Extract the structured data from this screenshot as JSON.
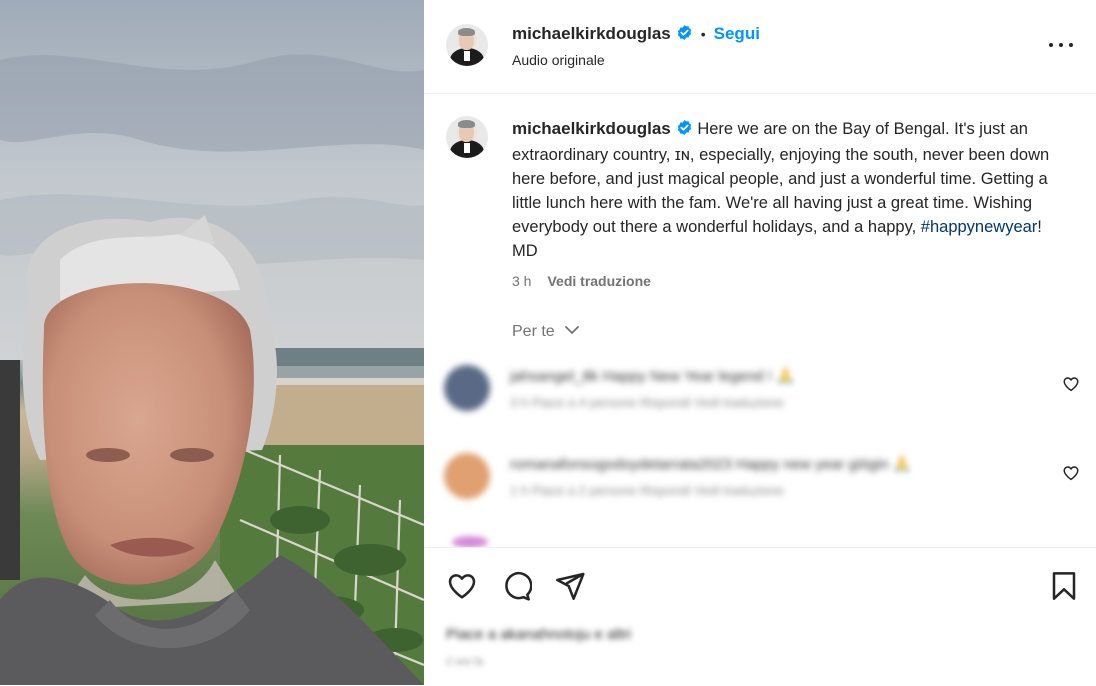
{
  "post": {
    "username": "michaelkirkdouglas",
    "follow_label": "Segui",
    "audio_label": "Audio originale",
    "separator": "•"
  },
  "caption": {
    "username": "michaelkirkdouglas",
    "text": "Here we are on the Bay of Bengal. It's just an extraordinary country, ɪɴ, especially, enjoying the south, never been down here before, and just magical people, and just a wonderful time. Getting a little lunch here with the fam. We're all having just a great time. Wishing everybody out there a wonderful holidays, and a happy, ",
    "hashtag": "#happynewyear",
    "suffix": "! MD",
    "time": "3 h",
    "translate_label": "Vedi traduzione"
  },
  "comments_section": {
    "label": "Per te",
    "comments": [
      {
        "text": "jahsangel_8k Happy New Year legend ! 🙏",
        "meta": "3 h    Piace a 4 persone    Rispondi    Vedi traduzione",
        "avatar_color": "#5a6a86"
      },
      {
        "text": "romanafonsogodoydetarrata2023 Happy new year giögin 🙏",
        "meta": "1 h    Piace a 2 persone    Rispondi    Vedi traduzione",
        "avatar_color": "#e0a070"
      }
    ]
  },
  "footer": {
    "likes_text": "Piace a akanahnotoju e altri",
    "date_text": "2 ore fa"
  },
  "icons": {
    "like": "heart-icon",
    "comment": "comment-icon",
    "share": "share-icon",
    "save": "bookmark-icon",
    "more": "more-options-icon",
    "verified": "verified-badge-icon",
    "chevron": "chevron-down-icon"
  },
  "colors": {
    "accent": "#0095f6",
    "hashtag": "#00376b",
    "verified": "#0095f6"
  }
}
